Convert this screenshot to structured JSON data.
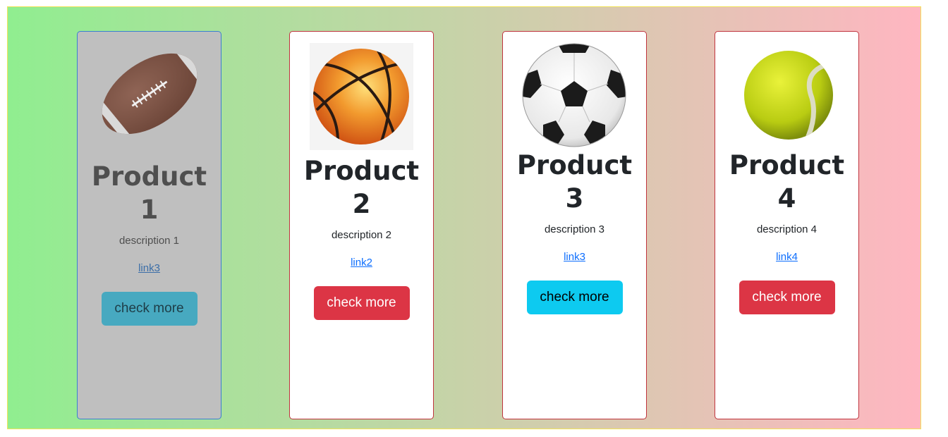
{
  "colors": {
    "gradient_start": "#90ee90",
    "gradient_end": "#ffb6c1",
    "info": "#0dcaf0",
    "danger": "#dc3545",
    "link": "#0d6efd"
  },
  "products": [
    {
      "title_line1": "Product",
      "title_line2": "1",
      "description": "description 1",
      "link": "link3",
      "button": "check more",
      "icon": "football-icon"
    },
    {
      "title_line1": "Product",
      "title_line2": "2",
      "description": "description 2",
      "link": "link2",
      "button": "check more",
      "icon": "basketball-icon"
    },
    {
      "title_line1": "Product",
      "title_line2": "3",
      "description": "description 3",
      "link": "link3",
      "button": "check more",
      "icon": "soccer-ball-icon"
    },
    {
      "title_line1": "Product",
      "title_line2": "4",
      "description": "description 4",
      "link": "link4",
      "button": "check more",
      "icon": "tennis-ball-icon"
    }
  ]
}
